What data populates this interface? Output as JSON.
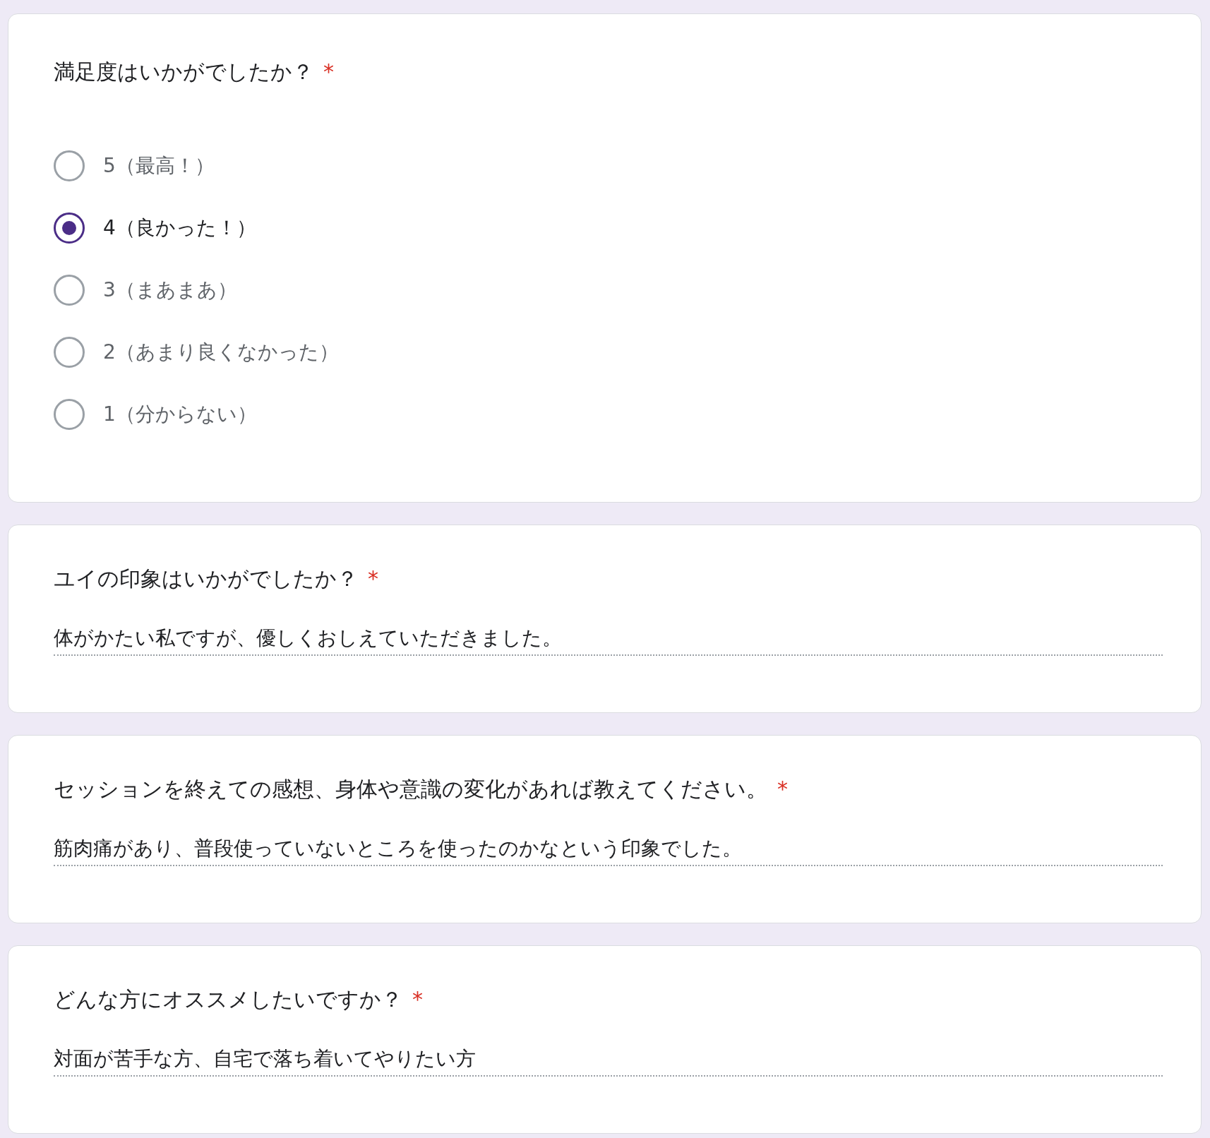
{
  "questions": [
    {
      "kind": "radio",
      "title": "満足度はいかがでしたか？",
      "required_mark": "*",
      "options": [
        {
          "label": "5（最高！）",
          "selected": false
        },
        {
          "label": "4（良かった！）",
          "selected": true
        },
        {
          "label": "3（まあまあ）",
          "selected": false
        },
        {
          "label": "2（あまり良くなかった）",
          "selected": false
        },
        {
          "label": "1（分からない）",
          "selected": false
        }
      ]
    },
    {
      "kind": "text",
      "title": "ユイの印象はいかがでしたか？",
      "required_mark": "*",
      "value": "体がかたい私ですが、優しくおしえていただきました。"
    },
    {
      "kind": "text",
      "title": "セッションを終えての感想、身体や意識の変化があれば教えてください。",
      "required_mark": "*",
      "value": "筋肉痛があり、普段使っていないところを使ったのかなという印象でした。"
    },
    {
      "kind": "text",
      "title": "どんな方にオススメしたいですか？",
      "required_mark": "*",
      "value": "対面が苦手な方、自宅で落ち着いてやりたい方"
    }
  ]
}
